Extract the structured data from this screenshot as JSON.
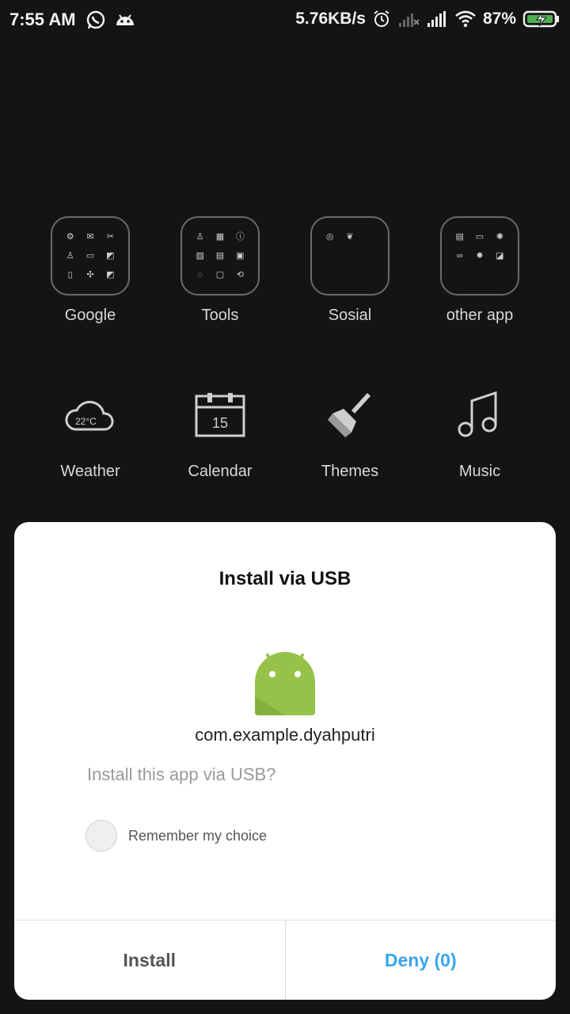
{
  "status_bar": {
    "time": "7:55 AM",
    "net_speed": "5.76KB/s",
    "battery": "87%",
    "icons": [
      "whatsapp-icon",
      "android-debug-icon",
      "alarm-icon",
      "signal-x-icon",
      "signal-icon",
      "wifi-icon",
      "battery-charging-icon"
    ]
  },
  "home": {
    "folders": [
      {
        "label": "Google",
        "items": [
          "⚙",
          "✉",
          "✂",
          "♙",
          "▭",
          "◩",
          "▯",
          "✣",
          "◩"
        ]
      },
      {
        "label": "Tools",
        "items": [
          "♙",
          "▦",
          "ⓘ",
          "▨",
          "▤",
          "▣",
          "◌",
          "▢",
          "⟲"
        ]
      },
      {
        "label": "Sosial",
        "items": [
          "◎",
          "❦",
          "",
          "",
          "",
          "",
          "",
          "",
          ""
        ]
      },
      {
        "label": "other app",
        "items": [
          "▤",
          "▭",
          "✺",
          "∞",
          "✹",
          "◪",
          "",
          "",
          ""
        ]
      }
    ],
    "apps": [
      {
        "label": "Weather",
        "icon": "weather-icon",
        "temp": "22°C"
      },
      {
        "label": "Calendar",
        "icon": "calendar-icon",
        "day": "15"
      },
      {
        "label": "Themes",
        "icon": "paintbrush-icon"
      },
      {
        "label": "Music",
        "icon": "music-icon"
      }
    ]
  },
  "dialog": {
    "title": "Install via USB",
    "package": "com.example.dyahputri",
    "question": "Install this app via USB?",
    "remember_label": "Remember my choice",
    "remember_checked": false,
    "install_label": "Install",
    "deny_label": "Deny (0)",
    "deny_color": "#3aa5ec",
    "android_color": "#97c24a"
  }
}
